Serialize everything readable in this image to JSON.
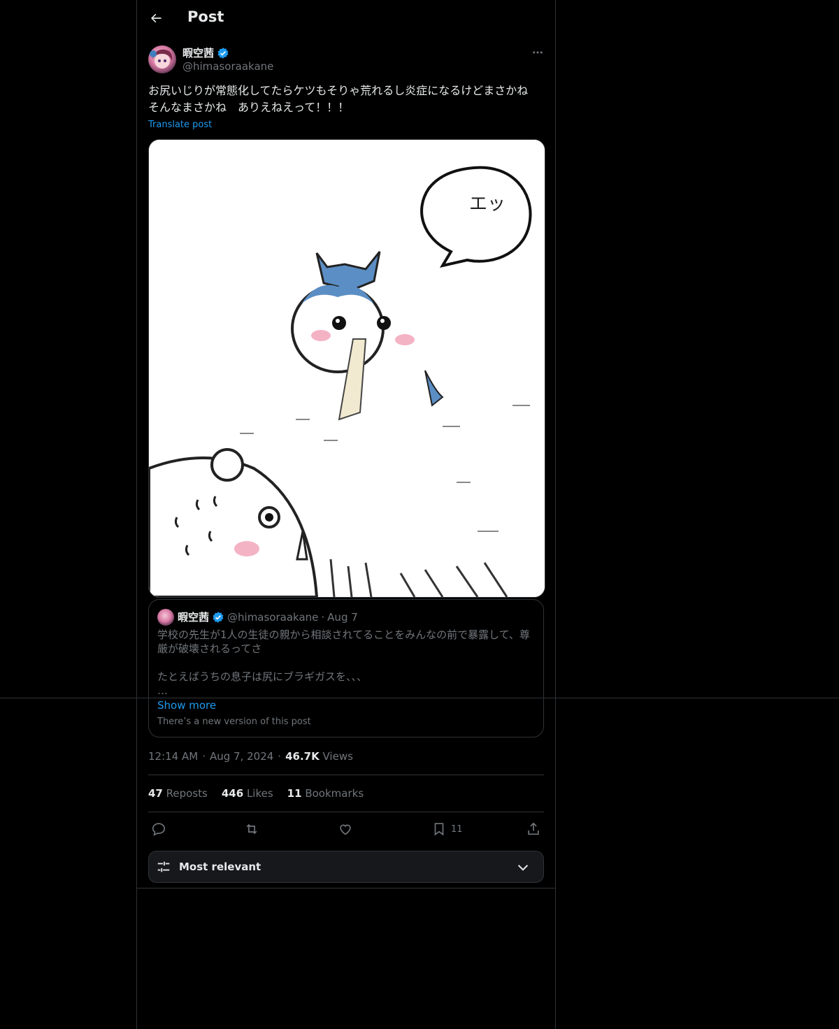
{
  "header": {
    "title": "Post"
  },
  "post": {
    "author": {
      "name": "暇空茜",
      "handle": "@himasoraakane",
      "verified": true
    },
    "text": "お尻いじりが常態化してたらケツもそりゃ荒れるし炎症になるけどまさかね　そんなまさかね　ありえねえって！！！",
    "translate_label": "Translate post",
    "media": {
      "speech_bubble_text": "エッ"
    },
    "quote": {
      "author_name": "暇空茜",
      "author_handle": "@himasoraakane",
      "separator": "·",
      "date": "Aug 7",
      "text": "学校の先生が1人の生徒の親から相談されてることをみんなの前で暴露して、尊厳が破壊されるってさ\n\nたとえばうちの息子は尻にブラギガスを、、、\n…",
      "show_more": "Show more",
      "new_version_note": "There’s a new version of this post"
    },
    "meta": {
      "time": "12:14 AM",
      "dot1": "·",
      "date": "Aug 7, 2024",
      "dot2": "·",
      "views_count": "46.7K",
      "views_label": "Views"
    },
    "stats": {
      "reposts_count": "47",
      "reposts_label": "Reposts",
      "likes_count": "446",
      "likes_label": "Likes",
      "bookmarks_count": "11",
      "bookmarks_label": "Bookmarks"
    },
    "actions": {
      "bookmark_count": "11"
    }
  },
  "sort": {
    "label": "Most relevant"
  },
  "colors": {
    "background": "#000000",
    "accent": "#1d9bf0",
    "muted": "#71767b",
    "text": "#e7e9ea",
    "border": "#2f3336"
  }
}
